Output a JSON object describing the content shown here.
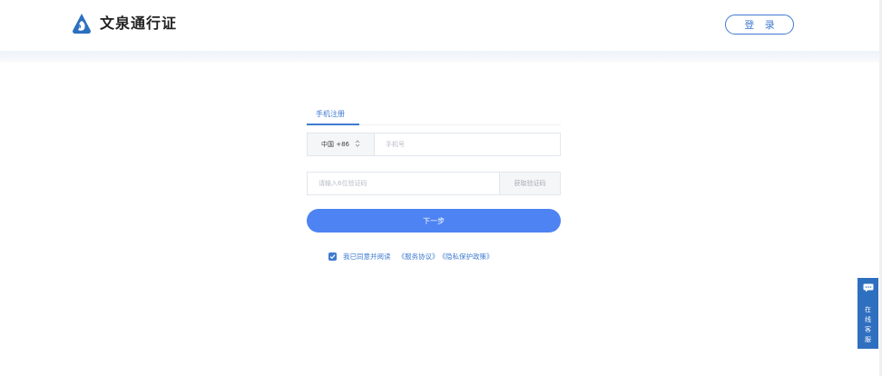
{
  "header": {
    "app_name": "文泉通行证",
    "login_label": "登 录",
    "brand_color": "#2b6fc0"
  },
  "tabs": [
    {
      "label": "手机注册",
      "active": true
    }
  ],
  "form": {
    "country_code": "中国 +86",
    "phone_placeholder": "手机号",
    "code_placeholder": "请输入6位验证码",
    "get_code_label": "获取验证码",
    "next_label": "下一步",
    "agree_checked": true,
    "agree_text": "我已同意并阅读",
    "service_agreement": "《服务协议》",
    "privacy_policy": "《隐私保护政策》"
  },
  "widget": {
    "online_service": "在线客服",
    "icon": "chat-icon"
  },
  "colors": {
    "accent": "#3f7bd0",
    "primary_button": "#4d83f3",
    "service_widget": "#2f6fbf"
  }
}
